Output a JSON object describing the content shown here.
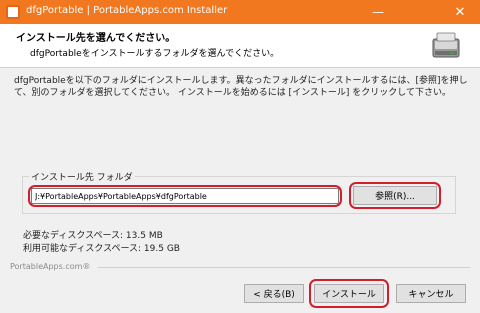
{
  "window": {
    "title": "dfgPortable | PortableApps.com Installer",
    "minimize_glyph": "—",
    "close_glyph": "✕"
  },
  "header": {
    "title": "インストール先を選んでください。",
    "subtitle": "dfgPortableをインストールするフォルダを選んでください。",
    "icon": "disk-icon"
  },
  "instructions": "dfgPortableを以下のフォルダにインストールします。異なったフォルダにインストールするには、[参照]を押して、別のフォルダを選択してください。 インストールを始めるには [インストール] をクリックして下さい。",
  "destination": {
    "group_label": "インストール先 フォルダ",
    "path_value": "J:¥PortableApps¥PortableApps¥dfgPortable",
    "browse_label": "参照(R)..."
  },
  "space": {
    "required": "必要なディスクスペース: 13.5 MB",
    "available": "利用可能なディスクスペース: 19.5 GB"
  },
  "footer": {
    "brand": "PortableApps.com®",
    "back_label": "< 戻る(B)",
    "install_label": "インストール",
    "cancel_label": "キャンセル"
  },
  "colors": {
    "titlebar": "#f2781f",
    "highlight": "#d11f2c"
  }
}
